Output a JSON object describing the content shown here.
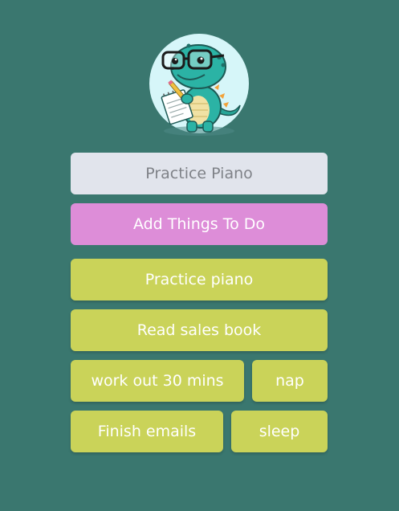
{
  "input": {
    "placeholder": "Practice Piano"
  },
  "add_button": {
    "label": "Add Things To Do"
  },
  "tasks": [
    {
      "label": "Practice piano"
    },
    {
      "label": "Read sales book"
    },
    {
      "label": "work out 30 mins"
    },
    {
      "label": "nap"
    },
    {
      "label": "Finish emails"
    },
    {
      "label": "sleep"
    }
  ],
  "colors": {
    "background": "#3a776f",
    "input_bg": "#e1e4ec",
    "add_button": "#dd8dd8",
    "task_button": "#cad359",
    "mascot": "#2bb3a5"
  },
  "mascot": {
    "icon": "dinosaur-with-glasses-and-notepad"
  }
}
